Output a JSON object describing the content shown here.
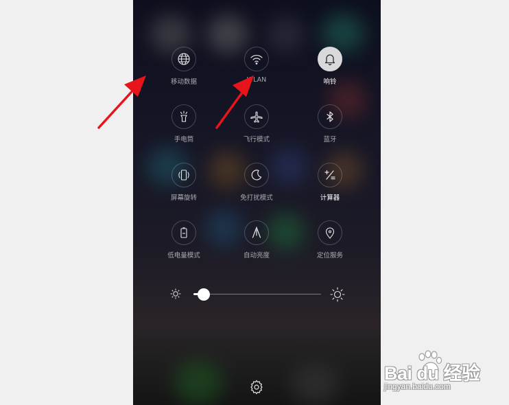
{
  "tiles": [
    {
      "label": "移动数据",
      "icon": "globe-icon",
      "active": false
    },
    {
      "label": "WLAN",
      "icon": "wifi-icon",
      "active": false
    },
    {
      "label": "响铃",
      "icon": "bell-icon",
      "active": true
    },
    {
      "label": "手电筒",
      "icon": "flashlight-icon",
      "active": false
    },
    {
      "label": "飞行模式",
      "icon": "airplane-icon",
      "active": false
    },
    {
      "label": "蓝牙",
      "icon": "bluetooth-icon",
      "active": false
    },
    {
      "label": "屏幕旋转",
      "icon": "rotate-icon",
      "active": false
    },
    {
      "label": "免打扰模式",
      "icon": "moon-icon",
      "active": false
    },
    {
      "label": "计算器",
      "icon": "calculator-icon",
      "active": false
    },
    {
      "label": "低电量模式",
      "icon": "battery-icon",
      "active": false
    },
    {
      "label": "自动亮度",
      "icon": "auto-brightness-icon",
      "active": false
    },
    {
      "label": "定位服务",
      "icon": "location-icon",
      "active": false
    }
  ],
  "brightness": {
    "level": 0.08
  },
  "watermark": {
    "logo": "Bai du 经验",
    "url": "jingyan.baidu.com"
  },
  "colors": {
    "arrow": "#e8141c",
    "active_tile": "#d9d9dc"
  }
}
